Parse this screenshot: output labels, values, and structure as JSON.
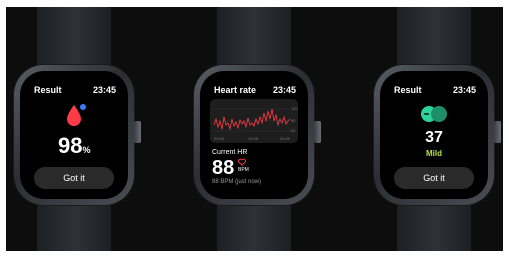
{
  "watches": [
    {
      "title": "Result",
      "time": "23:45",
      "value": "98",
      "unit": "%",
      "button": "Got it",
      "icon": "blood-drop-icon"
    },
    {
      "title": "Heart rate",
      "time": "23:45",
      "chart_ticks": [
        "00:00",
        "12:00",
        "24:00"
      ],
      "chart_y": [
        "120",
        "80",
        "60"
      ],
      "label": "Current HR",
      "value": "88",
      "unit": "BPM",
      "sub": "88 BPM (just now)",
      "icon": "heart-icon"
    },
    {
      "title": "Result",
      "time": "23:45",
      "value": "37",
      "status": "Mild",
      "button": "Got it",
      "icon": "stress-faces-icon"
    }
  ],
  "colors": {
    "accent_red": "#ff3b47",
    "accent_green": "#2bd49a",
    "mild": "#b8e04a"
  }
}
